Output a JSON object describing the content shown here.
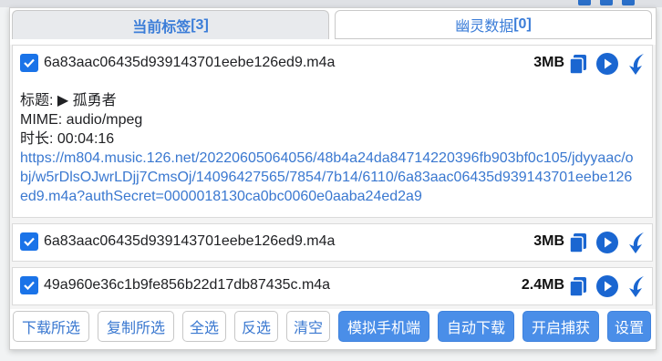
{
  "tabs": [
    {
      "label": "当前标签",
      "count": "[3]"
    },
    {
      "label": "幽灵数据",
      "count": "[0]"
    }
  ],
  "items": [
    {
      "filename": "6a83aac06435d939143701eebe126ed9.m4a",
      "size": "3MB",
      "checked": true,
      "details": {
        "title_label": "标题:",
        "title_value": "▶ 孤勇者",
        "mime_label": "MIME:",
        "mime_value": "audio/mpeg",
        "duration_label": "时长:",
        "duration_value": "00:04:16",
        "url": "https://m804.music.126.net/20220605064056/48b4a24da84714220396fb903bf0c105/jdyyaac/obj/w5rDlsOJwrLDjj7CmsOj/14096427565/7854/7b14/6110/6a83aac06435d939143701eebe126ed9.m4a?authSecret=0000018130ca0bc0060e0aaba24ed2a9"
      }
    },
    {
      "filename": "6a83aac06435d939143701eebe126ed9.m4a",
      "size": "3MB",
      "checked": true
    },
    {
      "filename": "49a960e36c1b9fe856b22d17db87435c.m4a",
      "size": "2.4MB",
      "checked": true
    }
  ],
  "buttons": {
    "download_selected": "下载所选",
    "copy_selected": "复制所选",
    "select_all": "全选",
    "invert": "反选",
    "clear": "清空",
    "mobile": "模拟手机端",
    "auto_download": "自动下载",
    "capture": "开启捕获",
    "settings": "设置"
  },
  "colors": {
    "accent": "#3a78d0",
    "button_fill": "#4a8ee8",
    "checkbox": "#1a73e8"
  }
}
